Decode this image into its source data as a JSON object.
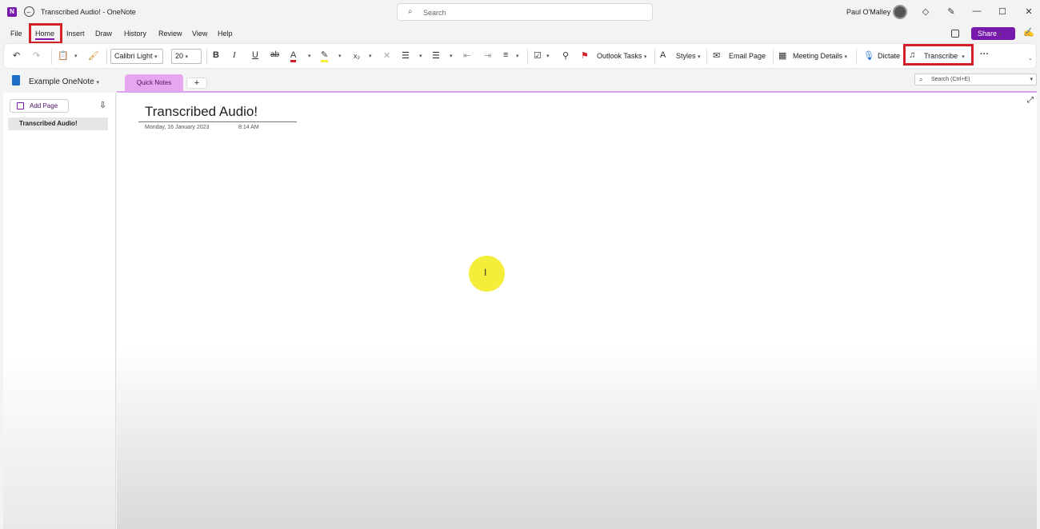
{
  "window": {
    "title": "Transcribed Audio!  -  OneNote",
    "app_logo": "N",
    "search_placeholder": "Search",
    "user_name": "Paul O'Malley"
  },
  "menu": {
    "tabs": [
      "File",
      "Home",
      "Insert",
      "Draw",
      "History",
      "Review",
      "View",
      "Help"
    ],
    "active": "Home",
    "share_label": "Share"
  },
  "ribbon": {
    "font_name": "Calibri Light",
    "font_size": "20",
    "bold": "B",
    "italic": "I",
    "underline": "U",
    "strike": "ab",
    "font_color": "A",
    "subscript": "x₂",
    "outlook_tasks": "Outlook Tasks",
    "styles": "Styles",
    "email_page": "Email Page",
    "meeting_details": "Meeting Details",
    "dictate": "Dictate",
    "transcribe": "Transcribe",
    "more": "···"
  },
  "notebook": {
    "name": "Example OneNote",
    "section": "Quick Notes",
    "add_section": "+",
    "page_search": "Search (Ctrl+E)"
  },
  "pages": {
    "add_label": "Add Page",
    "items": [
      "Transcribed Audio!"
    ]
  },
  "page": {
    "title": "Transcribed Audio!",
    "date": "Monday, 16 January 2023",
    "time": "8:14 AM",
    "cursor_glyph": "I"
  },
  "colors": {
    "accent": "#7719aa",
    "highlight_box": "#d1202a",
    "section_tab": "#e8a6ef",
    "cursor_dot": "#f4ee3b"
  }
}
